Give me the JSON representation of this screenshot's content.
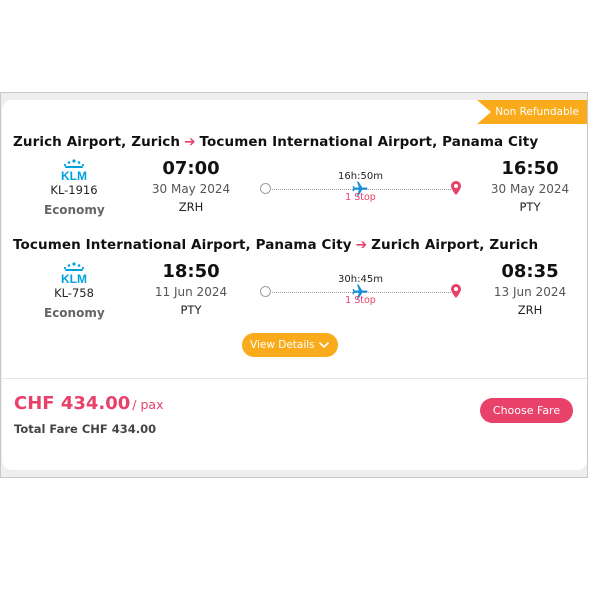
{
  "badge": "Non Refundable",
  "segments": [
    {
      "origin": "Zurich Airport, Zurich",
      "destination": "Tocumen International Airport, Panama City",
      "airline_logo": "KLM",
      "flight_no": "KL-1916",
      "cabin": "Economy",
      "dep_time": "07:00",
      "dep_date": "30 May 2024",
      "dep_code": "ZRH",
      "duration": "16h:50m",
      "stops": "1 Stop",
      "arr_time": "16:50",
      "arr_date": "30 May 2024",
      "arr_code": "PTY"
    },
    {
      "origin": "Tocumen International Airport, Panama City",
      "destination": "Zurich Airport, Zurich",
      "airline_logo": "KLM",
      "flight_no": "KL-758",
      "cabin": "Economy",
      "dep_time": "18:50",
      "dep_date": "11 Jun 2024",
      "dep_code": "PTY",
      "duration": "30h:45m",
      "stops": "1 Stop",
      "arr_time": "08:35",
      "arr_date": "13 Jun 2024",
      "arr_code": "ZRH"
    }
  ],
  "route_arrow": "➔",
  "view_details": "View Details",
  "price": "CHF 434.00",
  "per_pax": "/ pax",
  "total_fare": "Total Fare CHF 434.00",
  "choose_fare": "Choose Fare",
  "colors": {
    "accent": "#e8416a",
    "badge": "#f9ab1c",
    "klm_blue": "#00a1de",
    "plane_blue": "#1a8fd8"
  },
  "icons": [
    "klm-logo",
    "origin-circle-icon",
    "plane-icon",
    "location-pin-icon",
    "chevron-down-icon"
  ]
}
